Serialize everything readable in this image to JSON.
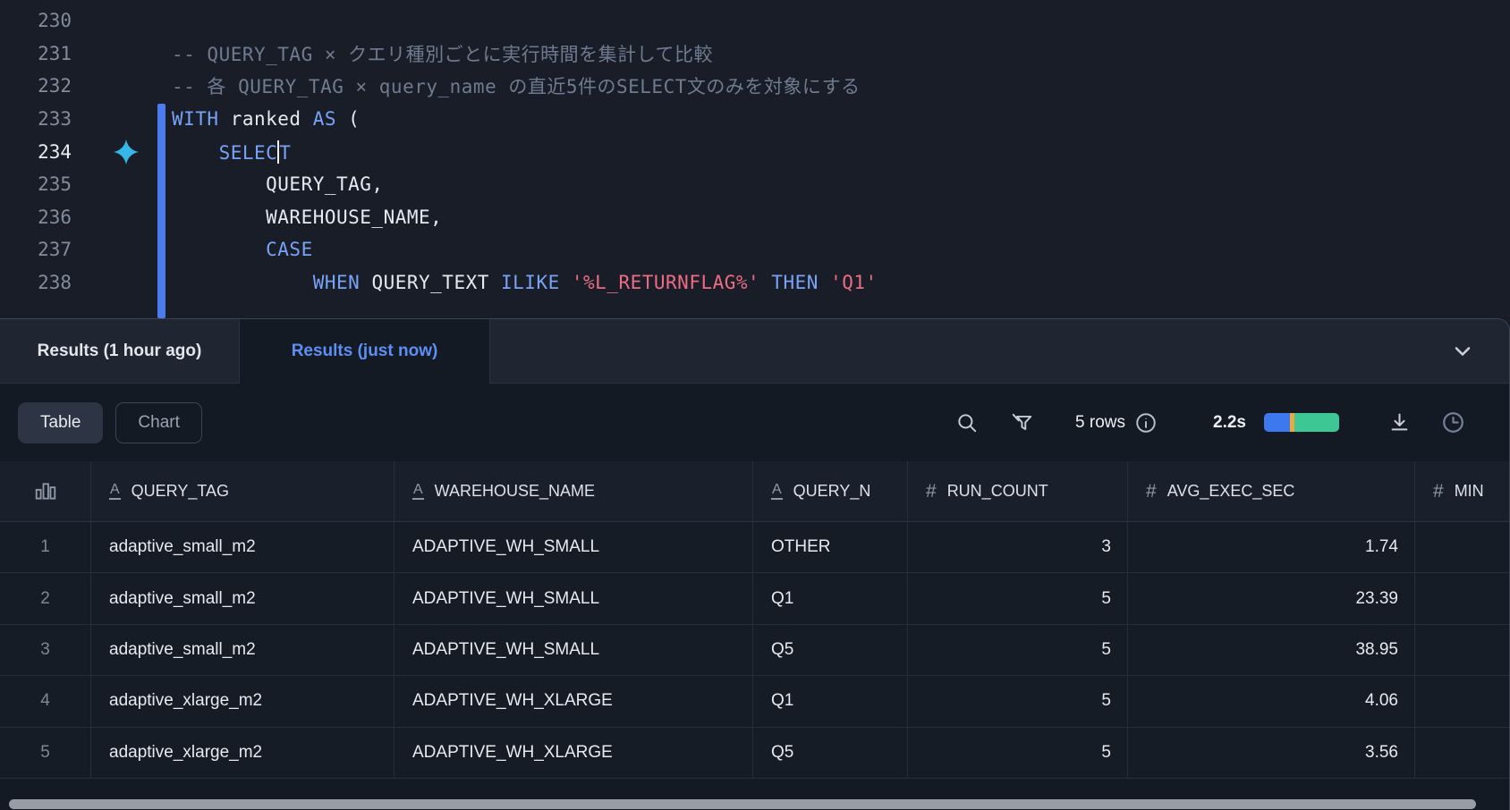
{
  "editor": {
    "lines": [
      {
        "num": "230",
        "tokens": []
      },
      {
        "num": "231",
        "tokens": [
          {
            "c": "com",
            "t": "-- QUERY_TAG × クエリ種別ごとに実行時間を集計して比較"
          }
        ]
      },
      {
        "num": "232",
        "tokens": [
          {
            "c": "com",
            "t": "-- 各 QUERY_TAG × query_name の直近5件のSELECT文のみを対象にする"
          }
        ]
      },
      {
        "num": "233",
        "tokens": [
          {
            "c": "kw",
            "t": "WITH"
          },
          {
            "c": "pl",
            "t": " ranked "
          },
          {
            "c": "kw",
            "t": "AS"
          },
          {
            "c": "pl",
            "t": " ("
          }
        ]
      },
      {
        "num": "234",
        "current": true,
        "sparkle": true,
        "tokens": [
          {
            "c": "kw",
            "t": "    SELEC"
          },
          {
            "c": "caret",
            "t": ""
          },
          {
            "c": "kw",
            "t": "T"
          }
        ]
      },
      {
        "num": "235",
        "tokens": [
          {
            "c": "pl",
            "t": "        QUERY_TAG,"
          }
        ]
      },
      {
        "num": "236",
        "tokens": [
          {
            "c": "pl",
            "t": "        WAREHOUSE_NAME,"
          }
        ]
      },
      {
        "num": "237",
        "tokens": [
          {
            "c": "kw",
            "t": "        CASE"
          }
        ]
      },
      {
        "num": "238",
        "tokens": [
          {
            "c": "pl",
            "t": "            "
          },
          {
            "c": "kw",
            "t": "WHEN"
          },
          {
            "c": "pl",
            "t": " QUERY_TEXT "
          },
          {
            "c": "kw",
            "t": "ILIKE"
          },
          {
            "c": "pl",
            "t": " "
          },
          {
            "c": "str",
            "t": "'%L_RETURNFLAG%'"
          },
          {
            "c": "pl",
            "t": " "
          },
          {
            "c": "kw",
            "t": "THEN"
          },
          {
            "c": "pl",
            "t": " "
          },
          {
            "c": "str",
            "t": "'Q1'"
          }
        ]
      }
    ]
  },
  "results": {
    "tabs": [
      {
        "label": "Results (1 hour ago)",
        "active": false
      },
      {
        "label": "Results (just now)",
        "active": true
      }
    ],
    "toolbar": {
      "view_table": "Table",
      "view_chart": "Chart",
      "row_count": "5 rows",
      "duration": "2.2s",
      "progress_segments": [
        {
          "name": "queued",
          "color": "#3d78ee",
          "pct": 34
        },
        {
          "name": "compile",
          "color": "#e9a93e",
          "pct": 7
        },
        {
          "name": "execute",
          "color": "#3cc795",
          "pct": 59
        }
      ]
    }
  },
  "table": {
    "columns": [
      {
        "label": "",
        "type": "rowbar"
      },
      {
        "label": "QUERY_TAG",
        "type": "text"
      },
      {
        "label": "WAREHOUSE_NAME",
        "type": "text"
      },
      {
        "label": "QUERY_N",
        "type": "text"
      },
      {
        "label": "RUN_COUNT",
        "type": "number"
      },
      {
        "label": "AVG_EXEC_SEC",
        "type": "number"
      },
      {
        "label": "MIN",
        "type": "number"
      }
    ],
    "rows": [
      {
        "n": "1",
        "cells": [
          "adaptive_small_m2",
          "ADAPTIVE_WH_SMALL",
          "OTHER",
          "3",
          "1.74",
          ""
        ]
      },
      {
        "n": "2",
        "cells": [
          "adaptive_small_m2",
          "ADAPTIVE_WH_SMALL",
          "Q1",
          "5",
          "23.39",
          ""
        ]
      },
      {
        "n": "3",
        "cells": [
          "adaptive_small_m2",
          "ADAPTIVE_WH_SMALL",
          "Q5",
          "5",
          "38.95",
          ""
        ]
      },
      {
        "n": "4",
        "cells": [
          "adaptive_xlarge_m2",
          "ADAPTIVE_WH_XLARGE",
          "Q1",
          "5",
          "4.06",
          ""
        ]
      },
      {
        "n": "5",
        "cells": [
          "adaptive_xlarge_m2",
          "ADAPTIVE_WH_XLARGE",
          "Q5",
          "5",
          "3.56",
          ""
        ]
      }
    ]
  },
  "colors": {
    "accent_blue": "#5f8ef3",
    "keyword": "#79a3f6",
    "string": "#ee6c83",
    "sparkle_cyan": "#36b6e8",
    "indicator_blue": "#4a7cf0"
  }
}
